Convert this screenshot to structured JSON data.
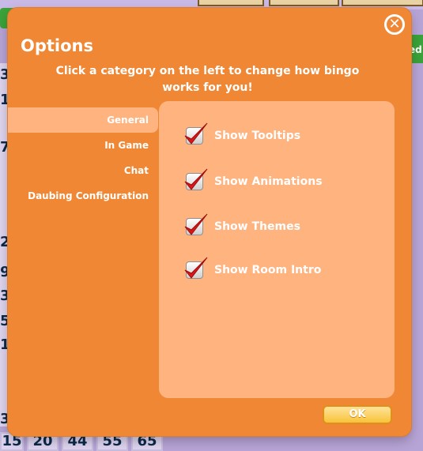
{
  "colors": {
    "dialog": "#f08734",
    "panel": "#ffb37f",
    "text": "#ffffff",
    "check": "#d81717",
    "ok_button": "#f7c33a",
    "background": "#b7a4d6"
  },
  "background": {
    "bottom_numbers": [
      "15",
      "20",
      "44",
      "55",
      "65"
    ],
    "left_numbers": [
      "3",
      "1",
      "7",
      "2",
      "9",
      "3",
      "5",
      "1",
      "3"
    ],
    "right_tab_text": "ed"
  },
  "dialog": {
    "title": "Options",
    "subtitle": "Click a category on the left to change how bingo works for you!",
    "close_icon": "close-circle-icon"
  },
  "nav": {
    "items": [
      {
        "label": "General",
        "active": true
      },
      {
        "label": "In Game",
        "active": false
      },
      {
        "label": "Chat",
        "active": false
      },
      {
        "label": "Daubing Configuration",
        "active": false
      }
    ]
  },
  "options": [
    {
      "label": "Show Tooltips",
      "checked": true
    },
    {
      "label": "Show Animations",
      "checked": true
    },
    {
      "label": "Show Themes",
      "checked": true
    },
    {
      "label": "Show Room Intro",
      "checked": true
    }
  ],
  "footer": {
    "ok_label": "OK"
  }
}
